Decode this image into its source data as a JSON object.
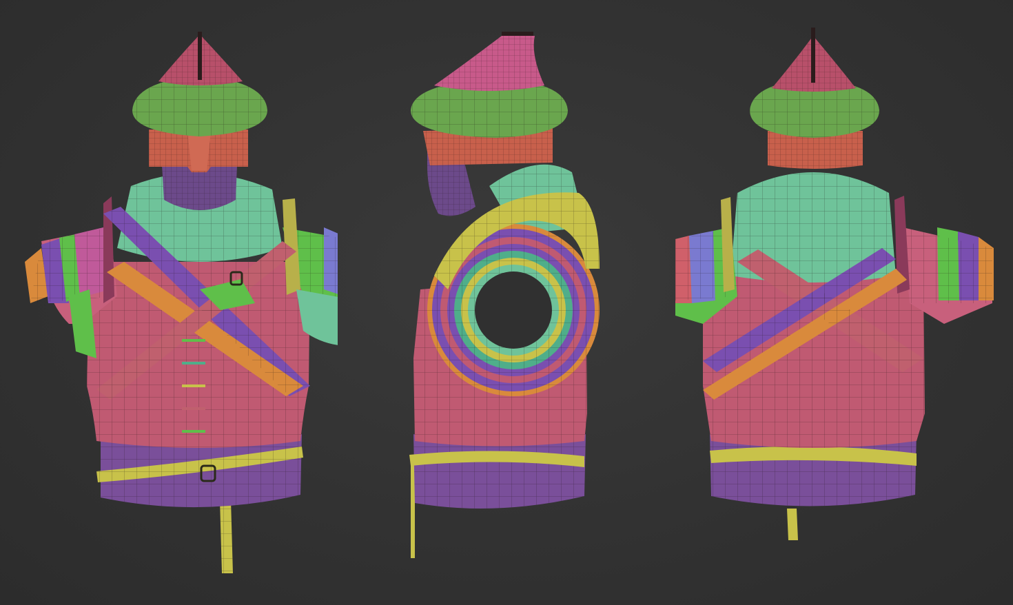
{
  "scene": {
    "background": "#303030",
    "views": [
      {
        "name": "front"
      },
      {
        "name": "side"
      },
      {
        "name": "back"
      }
    ]
  },
  "polygroup_colors": {
    "hat_top": "#b8506a",
    "hat_band": "#6aa64e",
    "headband": "#c8604c",
    "face": "#6c4a8a",
    "collar": "#6fc39a",
    "torso": "#c05a72",
    "pauldron_pink": "#c8607c",
    "strap_orange": "#d98a3c",
    "strap_purple": "#7a4fb0",
    "strap_green": "#5fbf4a",
    "belt_yellow": "#c8c24a",
    "skirt_purple": "#7a4f9a",
    "sleeve_teal": "#4fae8a"
  }
}
